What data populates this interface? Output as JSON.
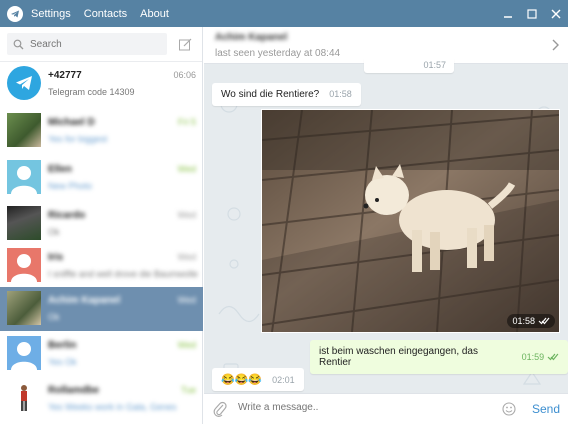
{
  "titlebar": {
    "menu": [
      "Settings",
      "Contacts",
      "About"
    ],
    "accent": "#5682a3"
  },
  "sidebar": {
    "search_placeholder": "Search",
    "dialogs": [
      {
        "name": "+42777",
        "time": "06:06",
        "preview": "Telegram code 14309"
      },
      {
        "name": "Michael D",
        "time": "Fri 5",
        "preview": "Yes for biggest"
      },
      {
        "name": "Ellen",
        "time": "Wed",
        "preview": "New Photo"
      },
      {
        "name": "Ricardo",
        "time": "Wed",
        "preview": "Ok"
      },
      {
        "name": "Iris",
        "time": "Wed",
        "preview": "I sniffle and well drove die Baumwolle"
      },
      {
        "name": "Achim Kapanel",
        "time": "Wed",
        "preview": "Ok"
      },
      {
        "name": "Berlin",
        "time": "Wed",
        "preview": "Yes Ok"
      },
      {
        "name": "Rollamdbe",
        "time": "Tue",
        "preview": "Yes Weeks work in Gala, Genes"
      }
    ]
  },
  "chat": {
    "header": {
      "name": "Achim Kapanel",
      "status": "last seen yesterday at 08:44"
    },
    "messages": {
      "partial_time": "01:57",
      "m1_text": "Wo sind die Rentiere?",
      "m1_time": "01:58",
      "photo_time": "01:58",
      "m2_text": "ist beim waschen eingegangen, das Rentier",
      "m2_time": "01:59",
      "m3_text": "😂😂😂",
      "m3_time": "02:01"
    },
    "composer": {
      "placeholder": "Write a message..",
      "send_label": "Send"
    }
  },
  "colors": {
    "send": "#3d8fd0",
    "active_dialog": "#6e8faf",
    "outgoing_bubble": "#effdde",
    "chat_bg": "#e6ebee"
  }
}
